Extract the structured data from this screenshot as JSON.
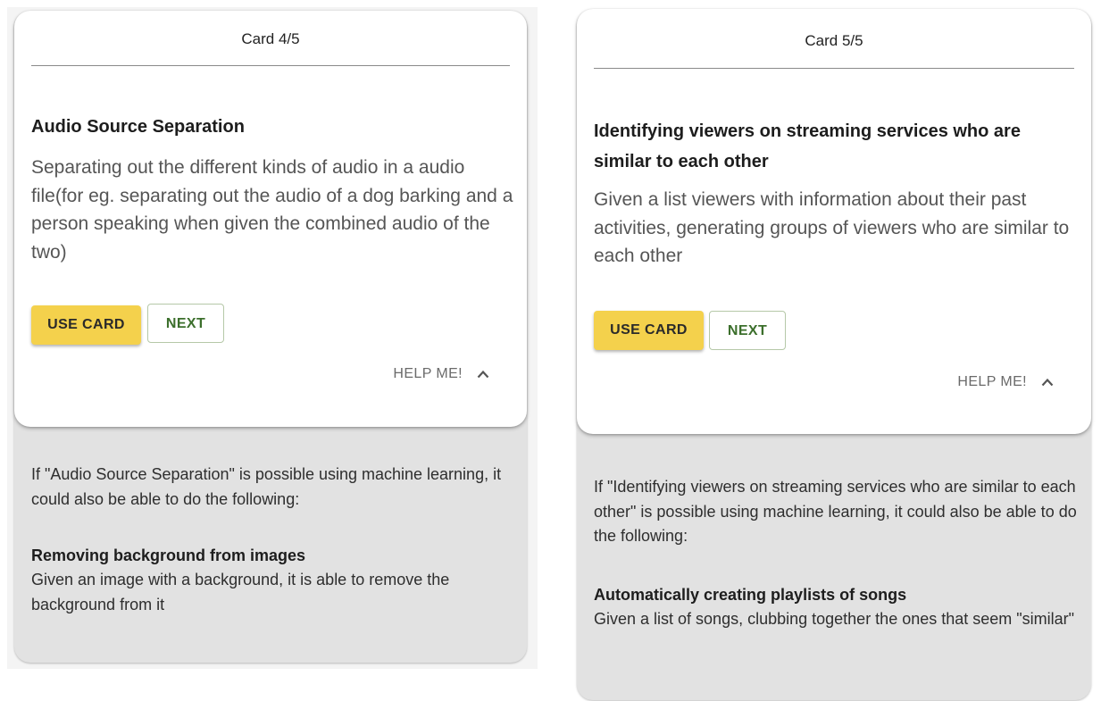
{
  "cards": [
    {
      "counter": "Card 4/5",
      "title": "Audio Source Separation",
      "description": "Separating out the different kinds of audio in a audio file(for eg. separating out the audio of a dog barking and a person speaking when given the combined audio of the two)",
      "use_label": "USE CARD",
      "next_label": "NEXT",
      "help_label": "HELP ME!",
      "help_intro": "If \"Audio Source Separation\" is possible using machine learning, it could also be able to do the following:",
      "related_title": "Removing background from images",
      "related_description": "Given an image with a background, it is able to remove the background from it"
    },
    {
      "counter": "Card 5/5",
      "title": "Identifying viewers on streaming services who are similar to each other",
      "description": "Given a list viewers with information about their past activities, generating groups of viewers who are similar to each other",
      "use_label": "USE CARD",
      "next_label": "NEXT",
      "help_label": "HELP ME!",
      "help_intro": "If \"Identifying viewers on streaming services who are similar to each other\" is possible using machine learning, it could also be able to do the following:",
      "related_title": "Automatically creating playlists of songs",
      "related_description": "Given a list of songs, clubbing together the ones that seem \"similar\""
    }
  ],
  "colors": {
    "use_button": "#f4d14c",
    "next_text": "#3c6f2c",
    "help_panel": "#e2e2e2"
  },
  "icons": {
    "help_toggle": "chevron-up-icon"
  }
}
